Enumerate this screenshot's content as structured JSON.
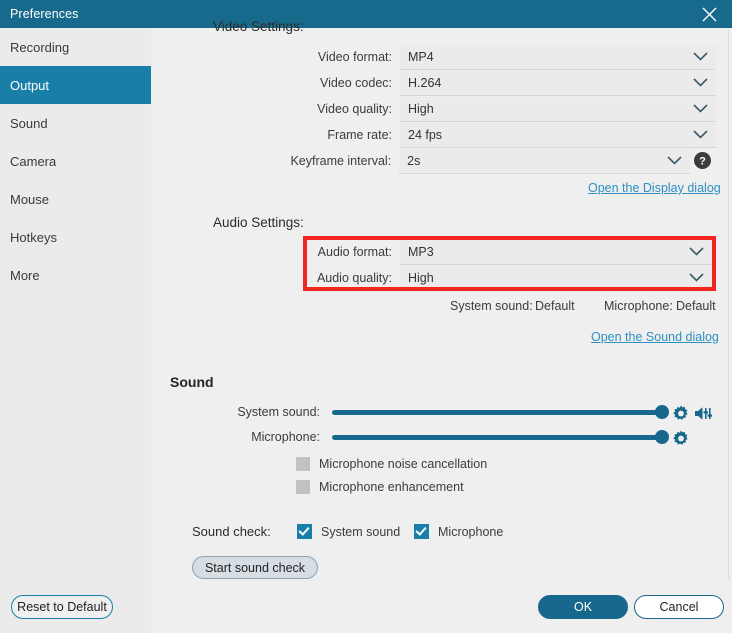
{
  "window": {
    "title": "Preferences",
    "close_icon": "close-icon"
  },
  "theme": {
    "accent": "#1a7fa8",
    "titlebar": "#186a8c",
    "slider": "#17688c",
    "link": "#2d8fc4",
    "highlight_box": "#f4241e",
    "background": "#efefef",
    "sidebar_bg": "#ebebeb"
  },
  "sidebar": {
    "items": [
      {
        "label": "Recording",
        "active": false
      },
      {
        "label": "Output",
        "active": true
      },
      {
        "label": "Sound",
        "active": false
      },
      {
        "label": "Camera",
        "active": false
      },
      {
        "label": "Mouse",
        "active": false
      },
      {
        "label": "Hotkeys",
        "active": false
      },
      {
        "label": "More",
        "active": false
      }
    ]
  },
  "video_settings": {
    "title": "Video Settings:",
    "rows": [
      {
        "label": "Video format:",
        "value": "MP4"
      },
      {
        "label": "Video codec:",
        "value": "H.264"
      },
      {
        "label": "Video quality:",
        "value": "High"
      },
      {
        "label": "Frame rate:",
        "value": "24 fps"
      },
      {
        "label": "Keyframe interval:",
        "value": "2s"
      }
    ],
    "help_icon": "help-icon",
    "link": "Open the Display dialog"
  },
  "audio_settings": {
    "title": "Audio Settings:",
    "rows": [
      {
        "label": "Audio format:",
        "value": "MP3"
      },
      {
        "label": "Audio quality:",
        "value": "High"
      }
    ],
    "device_defaults": {
      "system_sound_label": "System sound:",
      "system_sound_value": "Default",
      "microphone_label": "Microphone:",
      "microphone_value": "Default"
    },
    "link": "Open the Sound dialog"
  },
  "sound": {
    "title": "Sound",
    "sliders": [
      {
        "label": "System sound:",
        "value": 100
      },
      {
        "label": "Microphone:",
        "value": 100
      }
    ],
    "system_gear_icon": "gear-icon",
    "system_speaker_icon": "speaker-mixer-icon",
    "mic_gear_icon": "gear-icon",
    "checkboxes": [
      {
        "label": "Microphone noise cancellation",
        "checked": false
      },
      {
        "label": "Microphone enhancement",
        "checked": false
      }
    ],
    "sound_check": {
      "label": "Sound check:",
      "options": [
        {
          "label": "System sound",
          "checked": true
        },
        {
          "label": "Microphone",
          "checked": true
        }
      ],
      "button": "Start sound check"
    }
  },
  "footer": {
    "reset": "Reset to Default",
    "ok": "OK",
    "cancel": "Cancel"
  }
}
